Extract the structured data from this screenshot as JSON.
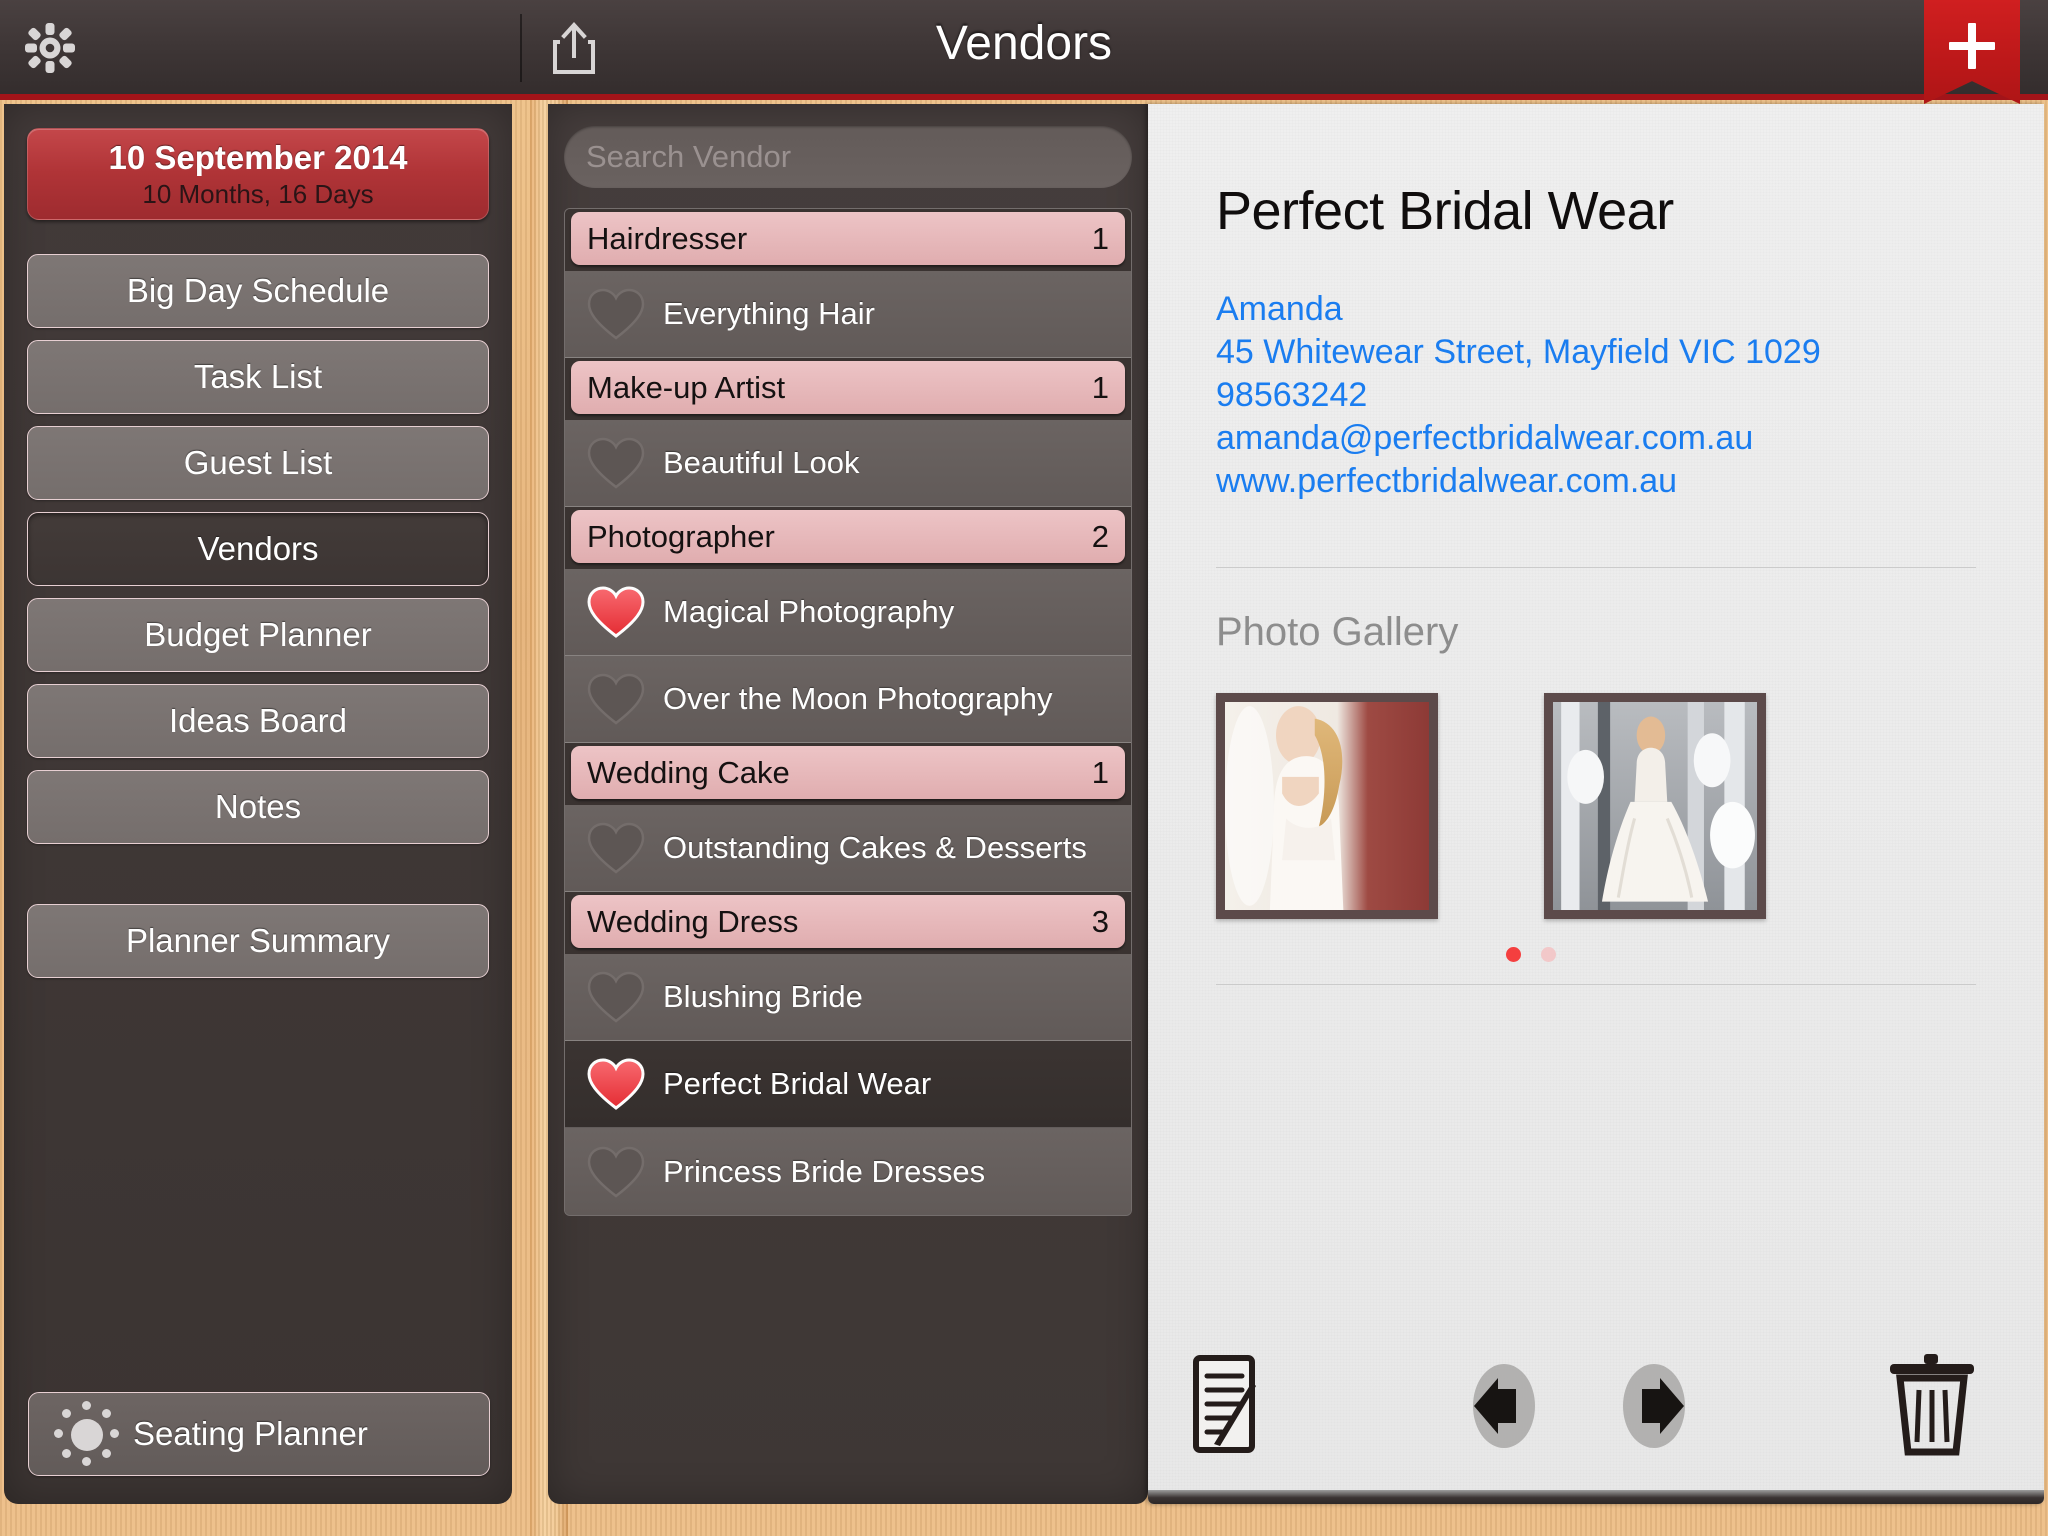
{
  "header": {
    "title": "Vendors",
    "gear_icon": "gear-icon",
    "share_icon": "share-icon",
    "add_icon": "plus-icon"
  },
  "sidebar": {
    "date_card": {
      "date": "10 September 2014",
      "countdown": "10 Months, 16 Days"
    },
    "menu": [
      {
        "label": "Big Day Schedule",
        "active": false
      },
      {
        "label": "Task List",
        "active": false
      },
      {
        "label": "Guest List",
        "active": false
      },
      {
        "label": "Vendors",
        "active": true
      },
      {
        "label": "Budget Planner",
        "active": false
      },
      {
        "label": "Ideas Board",
        "active": false
      },
      {
        "label": "Notes",
        "active": false
      }
    ],
    "summary": {
      "label": "Planner Summary"
    },
    "seating": {
      "label": "Seating Planner",
      "icon": "sun-icon"
    }
  },
  "list": {
    "search": {
      "placeholder": "Search Vendor",
      "value": ""
    },
    "sections": [
      {
        "category": "Hairdresser",
        "count": "1",
        "vendors": [
          {
            "name": "Everything Hair",
            "favorite": false,
            "selected": false
          }
        ]
      },
      {
        "category": "Make-up Artist",
        "count": "1",
        "vendors": [
          {
            "name": "Beautiful Look",
            "favorite": false,
            "selected": false
          }
        ]
      },
      {
        "category": "Photographer",
        "count": "2",
        "vendors": [
          {
            "name": "Magical Photography",
            "favorite": true,
            "selected": false
          },
          {
            "name": "Over the Moon Photography",
            "favorite": false,
            "selected": false
          }
        ]
      },
      {
        "category": "Wedding Cake",
        "count": "1",
        "vendors": [
          {
            "name": "Outstanding Cakes & Desserts",
            "favorite": false,
            "selected": false
          }
        ]
      },
      {
        "category": "Wedding Dress",
        "count": "3",
        "vendors": [
          {
            "name": "Blushing Bride",
            "favorite": false,
            "selected": false
          },
          {
            "name": "Perfect Bridal Wear",
            "favorite": true,
            "selected": true
          },
          {
            "name": "Princess Bride Dresses",
            "favorite": false,
            "selected": false
          }
        ]
      }
    ]
  },
  "detail": {
    "vendor_name": "Perfect Bridal Wear",
    "contact": {
      "person": "Amanda",
      "address": "45 Whitewear Street, Mayfield VIC 1029",
      "phone": "98563242",
      "email": "amanda@perfectbridalwear.com.au",
      "website": "www.perfectbridalwear.com.au"
    },
    "gallery": {
      "title": "Photo Gallery",
      "photo_count": 2,
      "page_dots": 2,
      "active_dot": 1
    },
    "toolbar": {
      "edit_icon": "notepad-pencil-icon",
      "previous_icon": "arrow-left-icon",
      "next_icon": "arrow-right-icon",
      "delete_icon": "trash-icon"
    }
  },
  "colors": {
    "accent_red": "#a21419",
    "ribbon_red": "#bc1819",
    "category_pink": "#e0adaf",
    "link_blue": "#1a7df0",
    "heart_red": "#f2484e",
    "wood": "#edbd85"
  }
}
